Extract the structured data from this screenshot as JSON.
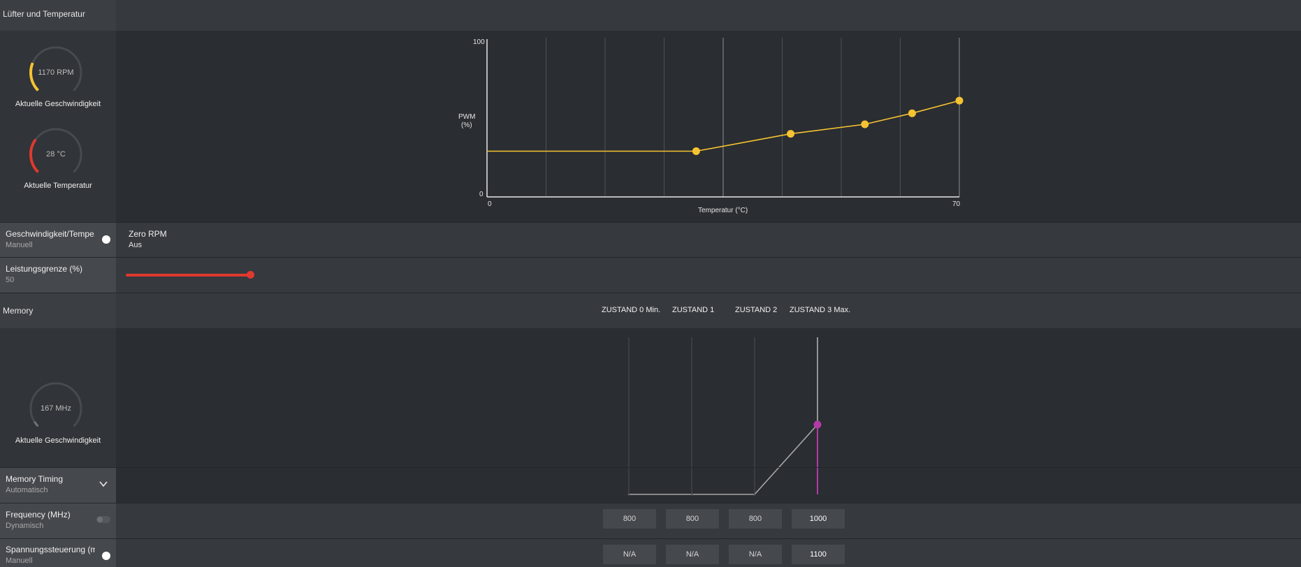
{
  "fan_section": {
    "title": "Lüfter und Temperatur",
    "speed_gauge": {
      "value": "1170 RPM",
      "label": "Aktuelle Geschwindigkeit",
      "fraction": 0.25
    },
    "temp_gauge": {
      "value": "28 °C",
      "label": "Aktuelle Temperatur",
      "fraction": 0.3
    }
  },
  "fan_chart": {
    "y_label_line1": "PWM",
    "y_label_line2": "(%)",
    "x_label": "Temperatur (°C)",
    "y_max_label": "100",
    "y_min_label": "0",
    "x_min_label": "0",
    "x_max_label": "70"
  },
  "chart_data": {
    "type": "line",
    "title": "",
    "xlabel": "Temperatur (°C)",
    "ylabel": "PWM (%)",
    "xlim": [
      0,
      70
    ],
    "ylim": [
      0,
      100
    ],
    "series": [
      {
        "values_x": [
          0,
          31,
          45,
          56,
          63,
          70
        ],
        "values_y": [
          29,
          29,
          40,
          46,
          53,
          61
        ]
      }
    ],
    "point_indices": [
      1,
      2,
      3,
      4,
      5
    ],
    "color": "#f5c332"
  },
  "fan_controls": {
    "speed_temp": {
      "title": "Geschwindigkeit/Tempe...",
      "value": "Manuell"
    },
    "zero_rpm": {
      "title": "Zero RPM",
      "value": "Aus"
    },
    "power_limit": {
      "title": "Leistungsgrenze (%)",
      "value": "50",
      "fraction": 0.5
    }
  },
  "memory_section": {
    "title": "Memory",
    "states": [
      "ZUSTAND 0 Min.",
      "ZUSTAND 1",
      "ZUSTAND 2",
      "ZUSTAND 3 Max."
    ],
    "gauge": {
      "value": "167 MHz",
      "label": "Aktuelle Geschwindigkeit",
      "fraction": 0.05
    }
  },
  "memory_chart_data": {
    "type": "line",
    "states": [
      "ZUSTAND 0 Min.",
      "ZUSTAND 1",
      "ZUSTAND 2",
      "ZUSTAND 3 Max."
    ],
    "values": [
      800,
      800,
      800,
      1000
    ],
    "active_state": 3,
    "line_color": "#a8a8a8",
    "marker_color": "#b23aa8"
  },
  "memory_controls": {
    "timing": {
      "title": "Memory Timing",
      "value": "Automatisch"
    },
    "frequency": {
      "title": "Frequency (MHz)",
      "value": "Dynamisch",
      "cells": [
        "800",
        "800",
        "800",
        "1000"
      ]
    },
    "voltage": {
      "title": "Spannungssteuerung (mV)",
      "value": "Manuell",
      "cells": [
        "N/A",
        "N/A",
        "N/A",
        "1100"
      ]
    }
  },
  "colors": {
    "accent_yellow": "#f5c332",
    "accent_red": "#e0392f",
    "accent_magenta": "#b23aa8"
  }
}
